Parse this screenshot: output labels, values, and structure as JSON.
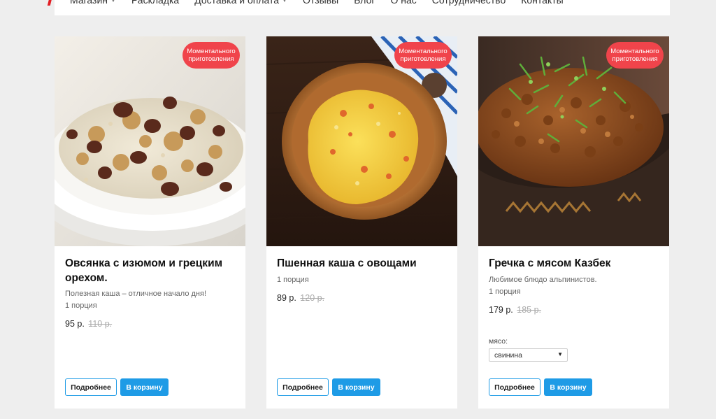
{
  "nav": {
    "items": [
      {
        "label": "Магазин",
        "has_dropdown": true
      },
      {
        "label": "Раскладка"
      },
      {
        "label": "Доставка и оплата",
        "has_dropdown": true
      },
      {
        "label": "Отзывы"
      },
      {
        "label": "Блог"
      },
      {
        "label": "О нас"
      },
      {
        "label": "Сотрудничество"
      },
      {
        "label": "Контакты"
      }
    ]
  },
  "products": [
    {
      "badge": "Моментального приготовления",
      "title": "Овсянка с изюмом и грецким орехом.",
      "description": "Полезная каша – отличное начало дня!",
      "portion": "1 порция",
      "price": "95 р.",
      "old_price": "110 р.",
      "more_label": "Подробнее",
      "cart_label": "В корзину"
    },
    {
      "badge": "Моментального приготовления",
      "title": "Пшенная каша с овощами",
      "portion": "1 порция",
      "price": "89 р.",
      "old_price": "120 р.",
      "more_label": "Подробнее",
      "cart_label": "В корзину"
    },
    {
      "badge": "Моментального приготовления",
      "title": "Гречка с мясом Казбек",
      "description": "Любимое блюдо альпинистов.",
      "portion": "1 порция",
      "price": "179 р.",
      "old_price": "185 р.",
      "option_label": "мясо:",
      "option_value": "свинина",
      "more_label": "Подробнее",
      "cart_label": "В корзину"
    }
  ],
  "colors": {
    "accent": "#1e9be6",
    "badge": "#f0444b",
    "background": "#eeeeee"
  }
}
